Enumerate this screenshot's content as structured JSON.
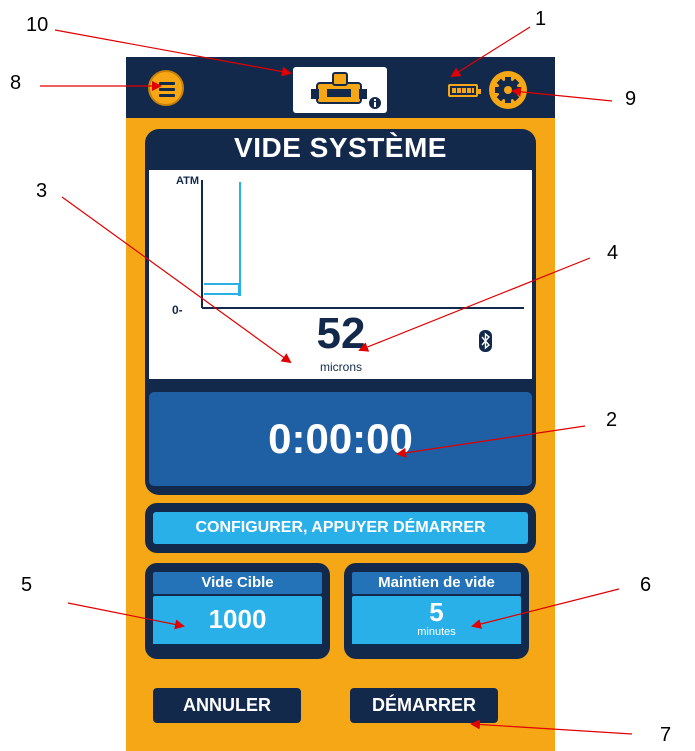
{
  "app": {
    "panel_title": "VIDE SYSTÈME",
    "graph": {
      "y_top_label": "ATM",
      "y_zero_label": "0-"
    },
    "reading": {
      "value": "52",
      "unit": "microns"
    },
    "timer": "0:00:00",
    "status_message": "CONFIGURER, APPUYER DÉMARRER",
    "target_vacuum": {
      "label": "Vide Cible",
      "value": "1000"
    },
    "vacuum_hold": {
      "label": "Maintien de vide",
      "value": "5",
      "unit": "minutes"
    },
    "buttons": {
      "cancel": "ANNULER",
      "start": "DÉMARRER"
    },
    "icons": [
      "menu-icon",
      "device-icon",
      "info-icon",
      "battery-icon",
      "settings-gear-icon",
      "bluetooth-icon"
    ]
  },
  "callouts": [
    "1",
    "2",
    "3",
    "4",
    "5",
    "6",
    "7",
    "8",
    "9",
    "10"
  ],
  "colors": {
    "background": "#f5a716",
    "navy": "#13294b",
    "timer_blue": "#1f5fa3",
    "cyan": "#2ab0e8",
    "callout_arrow": "#e00000"
  }
}
